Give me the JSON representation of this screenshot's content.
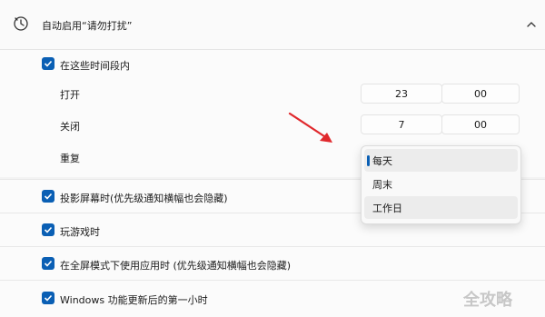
{
  "header": {
    "title": "自动启用“请勿打扰”",
    "icon": "clock-icon",
    "chevron": "chevron-up-icon"
  },
  "schedule": {
    "checkbox_label": "在这些时间段内",
    "on_label": "打开",
    "on_hour": "23",
    "on_minute": "00",
    "off_label": "关闭",
    "off_hour": "7",
    "off_minute": "00",
    "repeat_label": "重复",
    "repeat_options": [
      "每天",
      "周末",
      "工作日"
    ],
    "repeat_selected": "每天"
  },
  "rules": [
    {
      "label": "投影屏幕时(优先级通知横幅也会隐藏)",
      "checked": true
    },
    {
      "label": "玩游戏时",
      "checked": true
    },
    {
      "label": "在全屏模式下使用应用时 (优先级通知横幅也会隐藏)",
      "checked": true
    },
    {
      "label": "Windows 功能更新后的第一小时",
      "checked": true
    }
  ],
  "watermark": "全攻略",
  "colors": {
    "accent": "#0a5fb4",
    "arrow": "#e0282c"
  }
}
